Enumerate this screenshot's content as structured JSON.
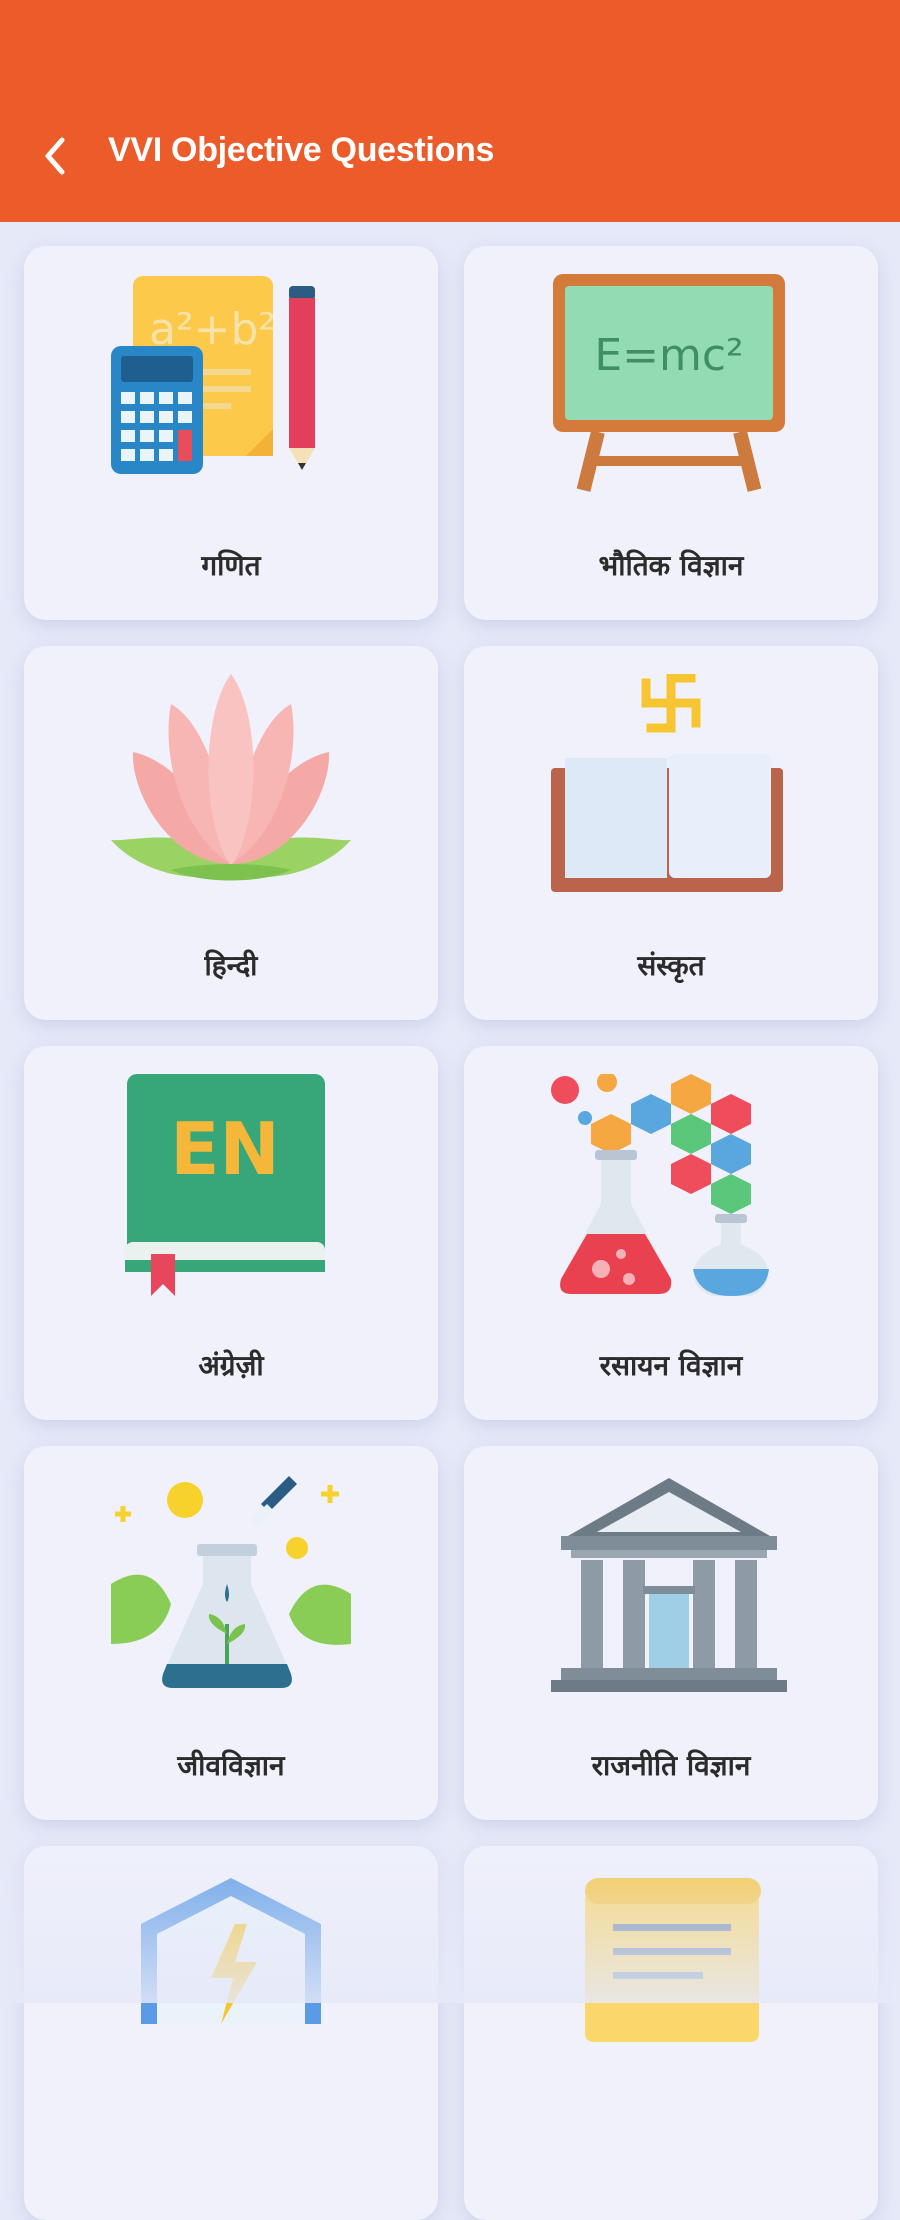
{
  "header": {
    "title": "VVI Objective Questions",
    "back_icon": "back-chevron-icon"
  },
  "subjects": [
    {
      "label": "गणित",
      "icon": "math-calculator-icon"
    },
    {
      "label": "भौतिक विज्ञान",
      "icon": "physics-blackboard-icon"
    },
    {
      "label": "हिन्दी",
      "icon": "lotus-icon"
    },
    {
      "label": "संस्कृत",
      "icon": "swastika-book-icon"
    },
    {
      "label": "अंग्रेज़ी",
      "icon": "english-book-icon"
    },
    {
      "label": "रसायन विज्ञान",
      "icon": "chemistry-flask-icon"
    },
    {
      "label": "जीवविज्ञान",
      "icon": "biology-flask-leaves-icon"
    },
    {
      "label": "राजनीति विज्ञान",
      "icon": "government-building-icon"
    },
    {
      "label": "",
      "icon": "electricity-shield-icon"
    },
    {
      "label": "",
      "icon": "scroll-document-icon"
    }
  ],
  "colors": {
    "appbar": "#ec5b2a",
    "background": "#e6e9f8",
    "card": "#f0f1fb"
  },
  "icon_text": {
    "physics_formula": "E=mc²",
    "english_badge": "EN"
  }
}
